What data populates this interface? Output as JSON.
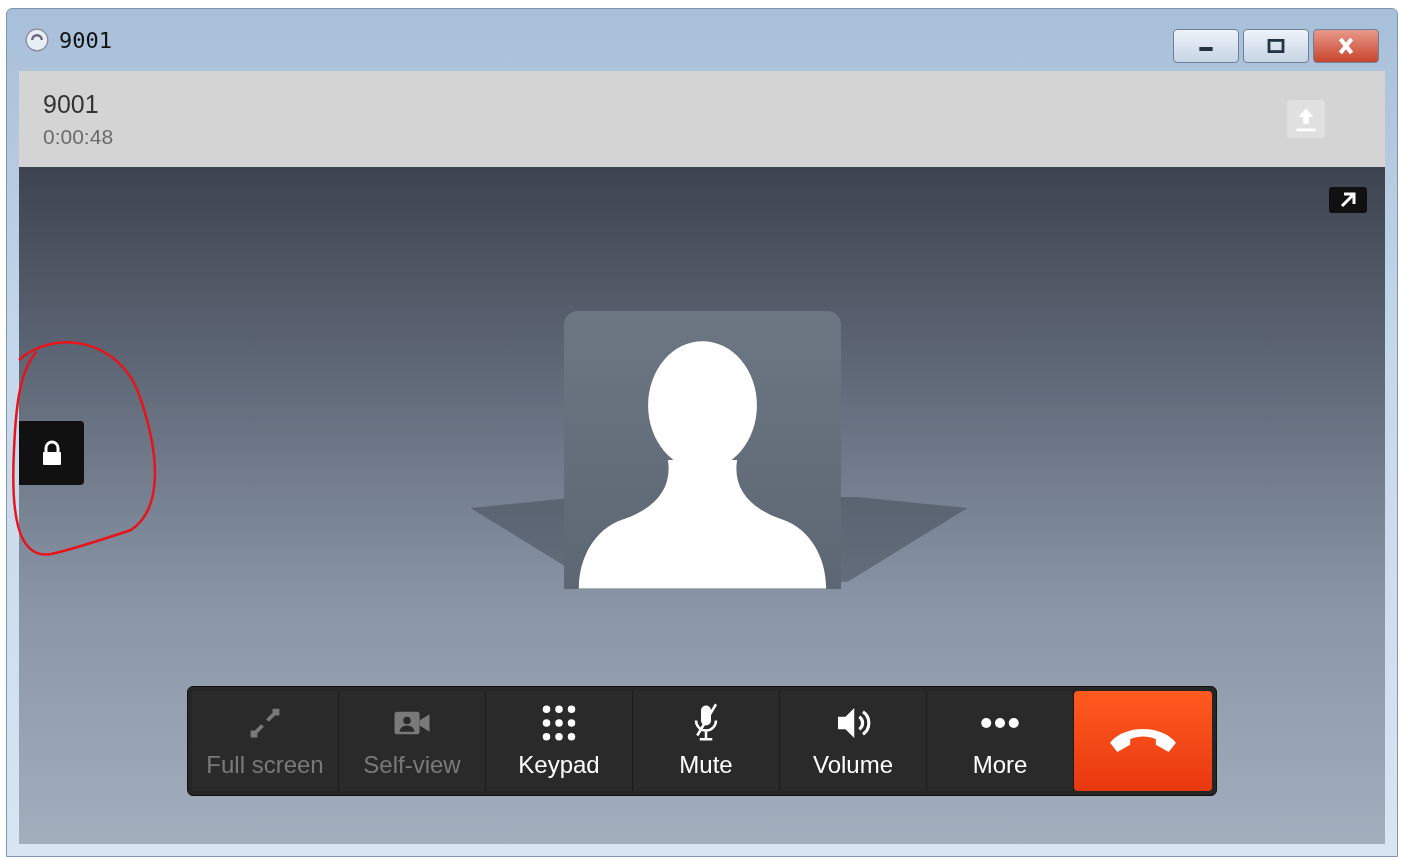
{
  "window": {
    "title": "9001"
  },
  "call": {
    "name": "9001",
    "duration": "0:00:48"
  },
  "toolbar": [
    {
      "kind": "fullscreen",
      "label": "Full screen",
      "disabled": true
    },
    {
      "kind": "selfview",
      "label": "Self-view",
      "disabled": true
    },
    {
      "kind": "keypad",
      "label": "Keypad",
      "disabled": false
    },
    {
      "kind": "mute",
      "label": "Mute",
      "disabled": false
    },
    {
      "kind": "volume",
      "label": "Volume",
      "disabled": false
    },
    {
      "kind": "more",
      "label": "More",
      "disabled": false
    },
    {
      "kind": "hangup",
      "disabled": false
    }
  ]
}
